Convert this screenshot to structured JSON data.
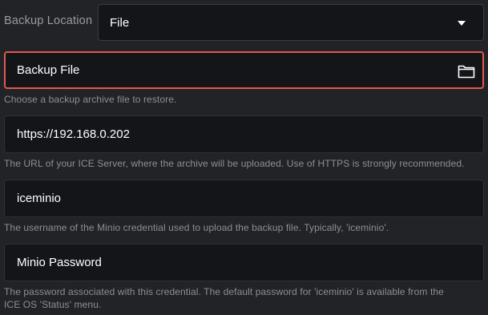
{
  "backup_location": {
    "label": "Backup Location",
    "selected": "File"
  },
  "backup_file": {
    "placeholder": "Backup File",
    "helper": "Choose a backup archive file to restore."
  },
  "server_url": {
    "value": "https://192.168.0.202",
    "helper": "The URL of your ICE Server, where the archive will be uploaded. Use of HTTPS is strongly recommended."
  },
  "minio_username": {
    "value": "iceminio",
    "helper": "The username of the Minio credential used to upload the backup file. Typically, 'iceminio'."
  },
  "minio_password": {
    "placeholder": "Minio Password",
    "helper_line1": "The password associated with this credential. The default password for 'iceminio' is available from the",
    "helper_line2": "ICE OS 'Status' menu."
  },
  "colors": {
    "background": "#222326",
    "field_background": "#141518",
    "error_border": "#e0584f",
    "helper_text": "#8d8f93"
  },
  "icons": {
    "dropdown": "chevron-down-icon",
    "file_picker": "folder-icon"
  }
}
